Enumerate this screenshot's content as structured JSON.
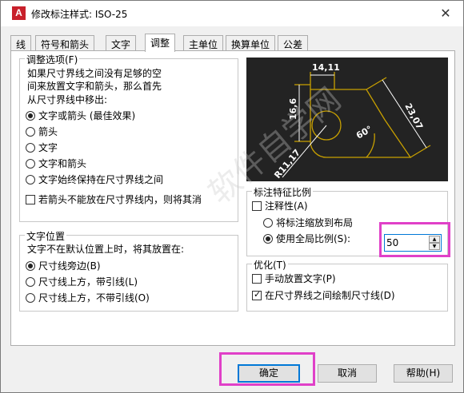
{
  "window": {
    "app_icon_letter": "A",
    "title": "修改标注样式: ISO-25",
    "close_glyph": "✕"
  },
  "tabs": [
    {
      "label": "线",
      "active": false
    },
    {
      "label": "符号和箭头",
      "active": false
    },
    {
      "label": "文字",
      "active": false
    },
    {
      "label": "调整",
      "active": true
    },
    {
      "label": "主单位",
      "active": false
    },
    {
      "label": "换算单位",
      "active": false
    },
    {
      "label": "公差",
      "active": false
    }
  ],
  "fit_options": {
    "legend": "调整选项(F)",
    "description": [
      "如果尺寸界线之间没有足够的空",
      "间来放置文字和箭头，那么首先",
      "从尺寸界线中移出:"
    ],
    "radios": [
      {
        "label": "文字或箭头 (最佳效果)",
        "selected": true
      },
      {
        "label": "箭头",
        "selected": false
      },
      {
        "label": "文字",
        "selected": false
      },
      {
        "label": "文字和箭头",
        "selected": false
      },
      {
        "label": "文字始终保持在尺寸界线之间",
        "selected": false
      }
    ],
    "suppress_arrows_label": "若箭头不能放在尺寸界线内，则将其消",
    "suppress_arrows_checked": false
  },
  "text_placement": {
    "legend": "文字位置",
    "description": "文字不在默认位置上时，将其放置在:",
    "radios": [
      {
        "label": "尺寸线旁边(B)",
        "selected": true
      },
      {
        "label": "尺寸线上方，带引线(L)",
        "selected": false
      },
      {
        "label": "尺寸线上方，不带引线(O)",
        "selected": false
      }
    ]
  },
  "preview": {
    "labels": [
      "14,11",
      "16,6",
      "23,07",
      "60°",
      "R11,17"
    ],
    "line_color": "#c8a000",
    "background": "#232323"
  },
  "scale": {
    "legend": "标注特征比例",
    "annotative_label": "注释性(A)",
    "annotative_checked": false,
    "radios": [
      {
        "label": "将标注缩放到布局",
        "selected": false
      },
      {
        "label": "使用全局比例(S):",
        "selected": true
      }
    ],
    "global_scale_value": "50"
  },
  "fine_tuning": {
    "legend": "优化(T)",
    "checks": [
      {
        "label": "手动放置文字(P)",
        "checked": false
      },
      {
        "label": "在尺寸界线之间绘制尺寸线(D)",
        "checked": true
      }
    ]
  },
  "buttons": {
    "ok": "确定",
    "cancel": "取消",
    "help": "帮助(H)"
  },
  "highlight_color": "#e040c8"
}
